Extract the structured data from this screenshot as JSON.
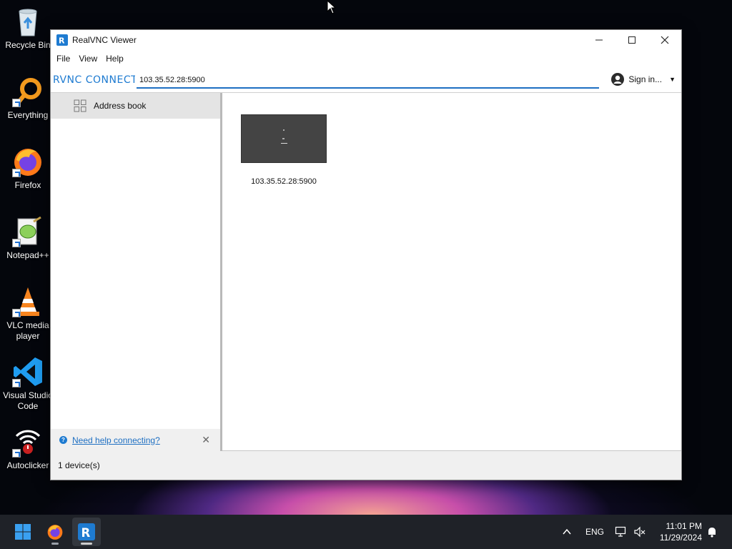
{
  "desktop": {
    "icons": [
      {
        "label": "Recycle Bin"
      },
      {
        "label": "Everything"
      },
      {
        "label": "Firefox"
      },
      {
        "label": "Notepad++"
      },
      {
        "label": "VLC media player"
      },
      {
        "label": "Visual Studio Code"
      },
      {
        "label": "Autoclicker"
      }
    ]
  },
  "window": {
    "title": "RealVNC Viewer",
    "controls": {
      "minimize": "—",
      "maximize": "☐",
      "close": "✕"
    },
    "menu": [
      "File",
      "View",
      "Help"
    ],
    "toolbar": {
      "logo": "RVNC CONNECT",
      "address_value": "103.35.52.28:5900",
      "signin_label": "Sign in..."
    },
    "sidebar": {
      "items": [
        {
          "label": "Address book",
          "icon": "grid-icon"
        }
      ],
      "help_link": "Need help connecting?"
    },
    "devices": [
      {
        "label": "103.35.52.28:5900"
      }
    ],
    "status": "1 device(s)"
  },
  "taskbar": {
    "language": "ENG",
    "time": "11:01 PM",
    "date": "11/29/2024"
  },
  "colors": {
    "accent": "#1e7bd1",
    "window_bg": "#ffffff",
    "sidebar_selected": "#e4e4e4",
    "taskbar_bg": "#1f2228"
  }
}
